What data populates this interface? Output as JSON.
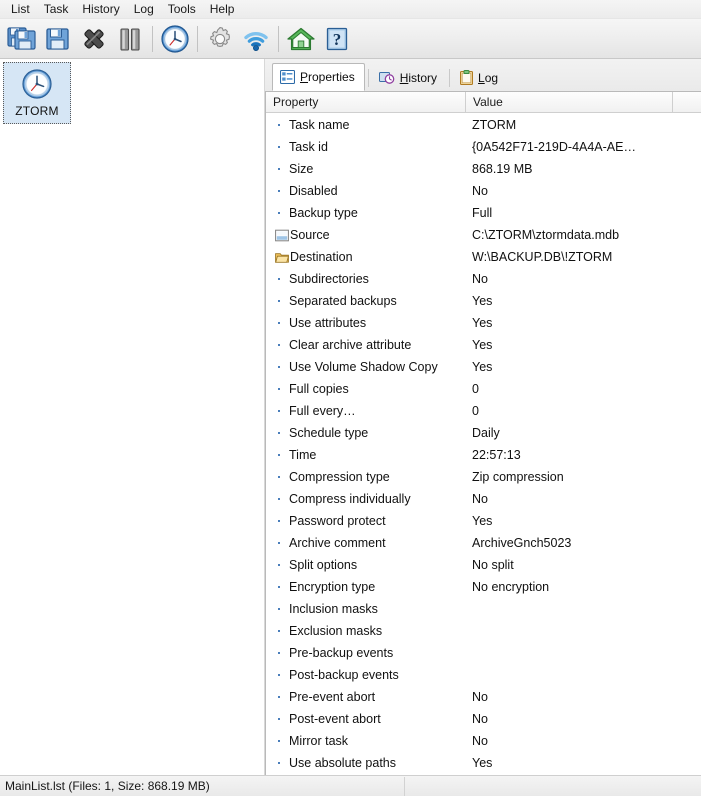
{
  "menubar": {
    "items": [
      {
        "label": "List"
      },
      {
        "label": "Task"
      },
      {
        "label": "History"
      },
      {
        "label": "Log"
      },
      {
        "label": "Tools"
      },
      {
        "label": "Help"
      }
    ]
  },
  "toolbar": {
    "buttons": [
      {
        "name": "save-all-icon",
        "tooltip": "Save all"
      },
      {
        "name": "save-icon",
        "tooltip": "Save"
      },
      {
        "name": "delete-icon",
        "tooltip": "Delete"
      },
      {
        "name": "pause-icon",
        "tooltip": "Pause"
      },
      {
        "name": "scheduler-clock-icon",
        "tooltip": "Scheduler"
      },
      {
        "name": "settings-gear-icon",
        "tooltip": "Settings"
      },
      {
        "name": "network-icon",
        "tooltip": "Network"
      },
      {
        "name": "home-icon",
        "tooltip": "Home"
      },
      {
        "name": "help-icon",
        "tooltip": "Help"
      }
    ]
  },
  "task_list": {
    "items": [
      {
        "label": "ZTORM",
        "icon": "clock-icon",
        "selected": true
      }
    ]
  },
  "tabs": [
    {
      "label": "Properties",
      "accel": "P",
      "icon": "properties-icon",
      "active": true
    },
    {
      "label": "History",
      "accel": "H",
      "icon": "history-icon",
      "active": false
    },
    {
      "label": "Log",
      "accel": "L",
      "icon": "log-icon",
      "active": false
    }
  ],
  "grid": {
    "headers": {
      "property": "Property",
      "value": "Value",
      "extra": ""
    },
    "rows": [
      {
        "icon": "bullet",
        "property": "Task name",
        "value": "ZTORM"
      },
      {
        "icon": "bullet",
        "property": "Task id",
        "value": "{0A542F71-219D-4A4A-AE…"
      },
      {
        "icon": "bullet",
        "property": "Size",
        "value": "868.19 MB"
      },
      {
        "icon": "bullet",
        "property": "Disabled",
        "value": "No"
      },
      {
        "icon": "bullet",
        "property": "Backup type",
        "value": "Full"
      },
      {
        "icon": "source",
        "property": "Source",
        "value": "C:\\ZTORM\\ztormdata.mdb"
      },
      {
        "icon": "destination",
        "property": "Destination",
        "value": "W:\\BACKUP.DB\\!ZTORM"
      },
      {
        "icon": "bullet",
        "property": "Subdirectories",
        "value": "No"
      },
      {
        "icon": "bullet",
        "property": "Separated backups",
        "value": "Yes"
      },
      {
        "icon": "bullet",
        "property": "Use attributes",
        "value": "Yes"
      },
      {
        "icon": "bullet",
        "property": "Clear archive attribute",
        "value": "Yes"
      },
      {
        "icon": "bullet",
        "property": "Use Volume Shadow Copy",
        "value": "Yes"
      },
      {
        "icon": "bullet",
        "property": "Full copies",
        "value": "0"
      },
      {
        "icon": "bullet",
        "property": "Full every…",
        "value": "0"
      },
      {
        "icon": "bullet",
        "property": "Schedule type",
        "value": "Daily"
      },
      {
        "icon": "bullet",
        "property": "Time",
        "value": "22:57:13"
      },
      {
        "icon": "bullet",
        "property": "Compression type",
        "value": "Zip compression"
      },
      {
        "icon": "bullet",
        "property": "Compress individually",
        "value": "No"
      },
      {
        "icon": "bullet",
        "property": "Password protect",
        "value": "Yes"
      },
      {
        "icon": "bullet",
        "property": "Archive comment",
        "value": "ArchiveGnch5023"
      },
      {
        "icon": "bullet",
        "property": "Split options",
        "value": "No split"
      },
      {
        "icon": "bullet",
        "property": "Encryption type",
        "value": "No encryption"
      },
      {
        "icon": "bullet",
        "property": "Inclusion masks",
        "value": ""
      },
      {
        "icon": "bullet",
        "property": "Exclusion masks",
        "value": ""
      },
      {
        "icon": "bullet",
        "property": "Pre-backup events",
        "value": ""
      },
      {
        "icon": "bullet",
        "property": "Post-backup events",
        "value": ""
      },
      {
        "icon": "bullet",
        "property": "Pre-event abort",
        "value": "No"
      },
      {
        "icon": "bullet",
        "property": "Post-event abort",
        "value": "No"
      },
      {
        "icon": "bullet",
        "property": "Mirror task",
        "value": "No"
      },
      {
        "icon": "bullet",
        "property": "Use absolute paths",
        "value": "Yes"
      }
    ]
  },
  "statusbar": {
    "text": "MainList.lst  (Files: 1, Size: 868.19 MB)"
  },
  "colors": {
    "accent_blue": "#3b78c8",
    "selection": "#d6e6f5",
    "folder_yellow": "#e9b84a",
    "window_gray": "#f0f0f0"
  }
}
